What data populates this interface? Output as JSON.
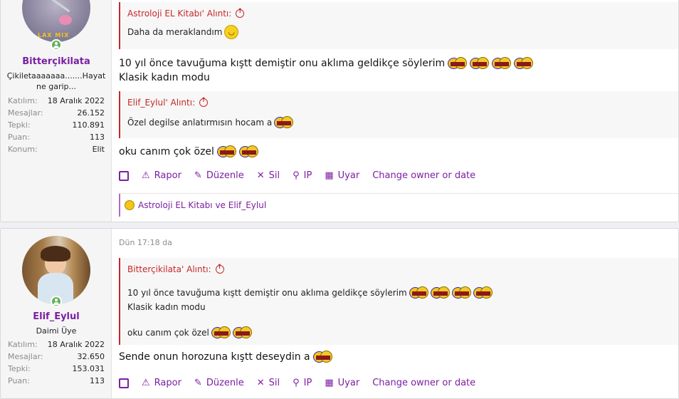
{
  "posts": [
    {
      "user": {
        "name": "Bitterçikilata",
        "title": "Çikiletaaaaaaa.......Hayat ne garip...",
        "stats": [
          {
            "label": "Katılım:",
            "value": "18 Aralık 2022"
          },
          {
            "label": "Mesajlar:",
            "value": "26.152"
          },
          {
            "label": "Tepki:",
            "value": "110.891"
          },
          {
            "label": "Puan:",
            "value": "113"
          },
          {
            "label": "Konum:",
            "value": "Elit"
          }
        ]
      },
      "quote1": {
        "author": "Astroloji EL Kitabı' Alıntı:",
        "text": "Daha da meraklandım"
      },
      "body1": [
        "10 yıl önce tavuğuma kıştt demiştir onu aklıma geldikçe söylerim",
        "Klasik kadın modu"
      ],
      "quote2": {
        "author": "Elif_Eylul' Alıntı:",
        "text": "Özel degilse anlatırmısın hocam a"
      },
      "body2": "oku canım çok özel",
      "reactions": "Astroloji EL Kitabı ve Elif_Eylul"
    },
    {
      "date": "Dün 17:18 da",
      "user": {
        "name": "Elif_Eylul",
        "title": "Daimi Üye",
        "stats": [
          {
            "label": "Katılım:",
            "value": "18 Aralık 2022"
          },
          {
            "label": "Mesajlar:",
            "value": "32.650"
          },
          {
            "label": "Tepki:",
            "value": "153.031"
          },
          {
            "label": "Puan:",
            "value": "113"
          }
        ]
      },
      "quote1": {
        "author": "Bitterçikilata' Alıntı:",
        "lines": [
          "10 yıl önce tavuğuma kıştt demiştir onu aklıma geldikçe söylerim",
          "Klasik kadın modu",
          "oku canım çok özel"
        ]
      },
      "body1": "Sende onun horozuna kıştt deseydin a"
    }
  ],
  "actions": {
    "rapor": "Rapor",
    "duzenle": "Düzenle",
    "sil": "Sil",
    "ip": "IP",
    "uyar": "Uyar",
    "change_owner": "Change owner or date"
  },
  "colors": {
    "accent": "#7b1fa2",
    "quote_border": "#c62828"
  }
}
